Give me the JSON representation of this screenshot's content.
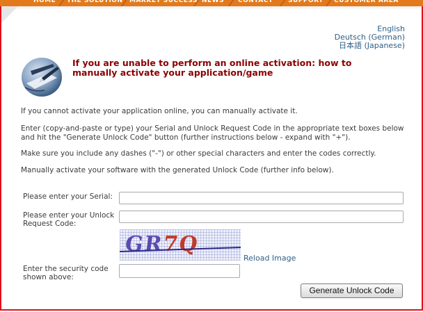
{
  "nav": {
    "items": [
      "HOME",
      "THE SOLUTION",
      "MARKET SUCCESS",
      "NEWS",
      "CONTACT",
      "SUPPORT",
      "CUSTOMER AREA"
    ]
  },
  "languages": [
    "English",
    "Deutsch (German)",
    "日本語 (Japanese)"
  ],
  "headline": "If you are unable to perform an online activation: how to manually activate your application/game",
  "paragraphs": [
    "If you cannot activate your application online, you can manually activate it.",
    "Enter (copy-and-paste or type) your Serial and Unlock Request Code in the appropriate text boxes below and hit the \"Generate Unlock Code\" button (further instructions below - expand with \"+\").",
    "Make sure you include any dashes (\"-\") or other special characters and enter the codes correctly.",
    "Manually activate your software with the generated Unlock Code (further info below)."
  ],
  "form": {
    "serial_label": "Please enter your Serial:",
    "serial_value": "",
    "unlock_label": "Please enter your Unlock Request Code:",
    "unlock_value": "",
    "captcha_text": "GR7Q",
    "reload_label": "Reload Image",
    "security_label": "Enter the security code shown above:",
    "security_value": "",
    "submit_label": "Generate Unlock Code"
  },
  "colors": {
    "headline": "#8b0000",
    "link": "#2e5e86",
    "nav": "#e27a1c",
    "frame": "#e0101a"
  }
}
